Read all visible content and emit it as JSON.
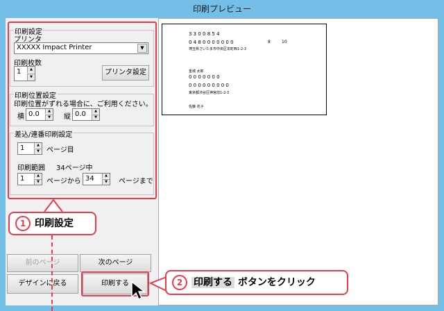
{
  "window": {
    "title": "印刷プレビュー"
  },
  "print_settings": {
    "group_label": "印刷設定",
    "printer_label": "プリンタ",
    "printer_value": "XXXXX Impact Printer",
    "copies_label": "印刷枚数",
    "copies_value": "1",
    "printer_settings_button": "プリンタ設定"
  },
  "position_settings": {
    "group_label": "印刷位置設定",
    "description": "印刷位置がずれる場合に、ご利用ください。",
    "horizontal_label": "横",
    "horizontal_value": "0.0",
    "vertical_label": "縦",
    "vertical_value": "0.0"
  },
  "serial_settings": {
    "group_label": "差込/連番印刷設定",
    "page_value": "1",
    "page_suffix": "ページ目",
    "range_label": "印刷範囲",
    "total_pages": "34ページ中",
    "from_value": "1",
    "from_suffix": "ページから",
    "to_value": "34",
    "to_suffix": "ページまで"
  },
  "buttons": {
    "prev_page": "前のページ",
    "next_page": "次のページ",
    "back_to_design": "デザインに戻る",
    "print": "印刷する"
  },
  "preview_page": {
    "line1": "3 3 0 0 8 5 4",
    "line2": "0 4 8 0 0 0 0 0 0 0",
    "line2_right1": "8",
    "line2_right2": "10",
    "line3": "埼玉県さいたま市中央区本町西1-2-3",
    "line4": "金城 太郎",
    "line5": "0 0 0 0 0 0 0",
    "line6": "0 0 0 0 0 0 0 0 0",
    "line7": "東京都渋谷区神宮前1-2-3",
    "line8": "佐藤 花子"
  },
  "annotations": {
    "callout1_number": "1",
    "callout1_text": "印刷設定",
    "callout2_number": "2",
    "callout2_highlight": "印刷する",
    "callout2_text": " ボタンをクリック"
  },
  "colors": {
    "titlebar": "#73bfe8",
    "annotation": "#e83a4a"
  }
}
